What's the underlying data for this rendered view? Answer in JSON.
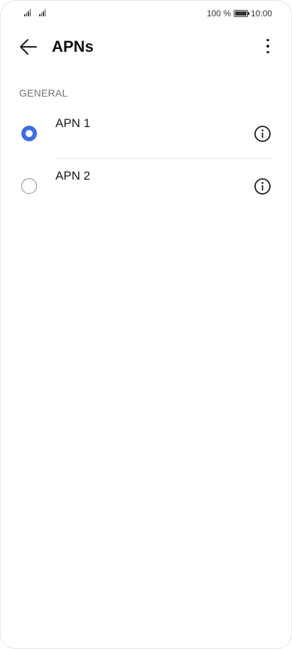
{
  "status_bar": {
    "battery_percent": "100 %",
    "time": "10:00",
    "icons": [
      "signal-icon",
      "signal-icon",
      "battery-icon"
    ]
  },
  "header": {
    "title": "APNs",
    "back_icon": "arrow-left-icon",
    "menu_icon": "more-vertical-icon"
  },
  "section": {
    "label": "GENERAL"
  },
  "apns": [
    {
      "name": "APN 1",
      "selected": true,
      "icon": "info-icon"
    },
    {
      "name": "APN 2",
      "selected": false,
      "icon": "info-icon"
    }
  ],
  "colors": {
    "accent": "#3f6de0",
    "divider": "#e3e3e3",
    "section_text": "#6f6f6f"
  }
}
